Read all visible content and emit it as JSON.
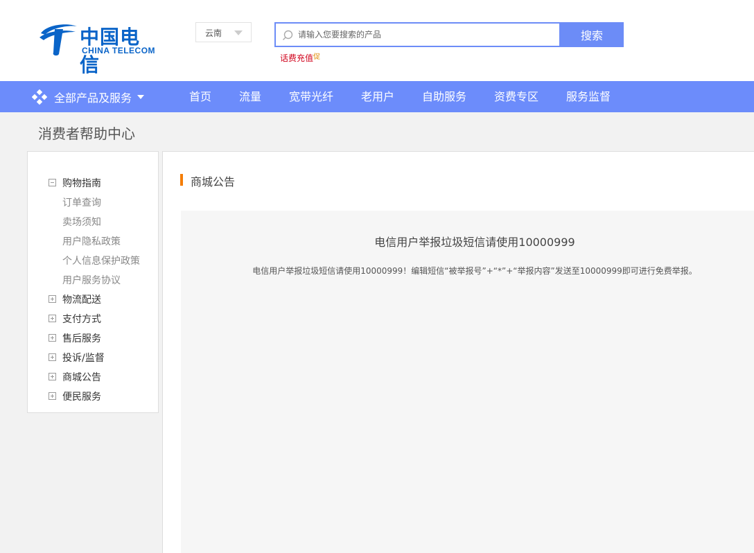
{
  "header": {
    "logo_cn": "中国电信",
    "logo_en": "CHINA TELECOM",
    "region": "云南",
    "search_placeholder": "请输入您要搜索的产品",
    "search_button": "搜索",
    "hot_link": "话费充值",
    "hot_badge": "促"
  },
  "nav": {
    "all_products": "全部产品及服务",
    "items": [
      "首页",
      "流量",
      "宽带光纤",
      "老用户",
      "自助服务",
      "资费专区",
      "服务监督"
    ]
  },
  "page_title": "消费者帮助中心",
  "sidebar": {
    "groups": [
      {
        "label": "购物指南",
        "expanded": true,
        "children": [
          "订单查询",
          "卖场须知",
          "用户隐私政策",
          "个人信息保护政策",
          "用户服务协议"
        ]
      },
      {
        "label": "物流配送",
        "expanded": false
      },
      {
        "label": "支付方式",
        "expanded": false
      },
      {
        "label": "售后服务",
        "expanded": false
      },
      {
        "label": "投诉/监督",
        "expanded": false
      },
      {
        "label": "商城公告",
        "expanded": false
      },
      {
        "label": "便民服务",
        "expanded": false
      }
    ]
  },
  "main": {
    "section_title": "商城公告",
    "notice_title": "电信用户举报垃圾短信请使用10000999",
    "notice_body": "电信用户举报垃圾短信请使用10000999！编辑短信“被举报号”+“*”+“举报内容”发送至10000999即可进行免费举报。"
  },
  "colors": {
    "nav_bg": "#6c8cfb",
    "brand_blue": "#0a64c8",
    "accent_orange": "#f47d05",
    "hot_red": "#d0021b"
  }
}
